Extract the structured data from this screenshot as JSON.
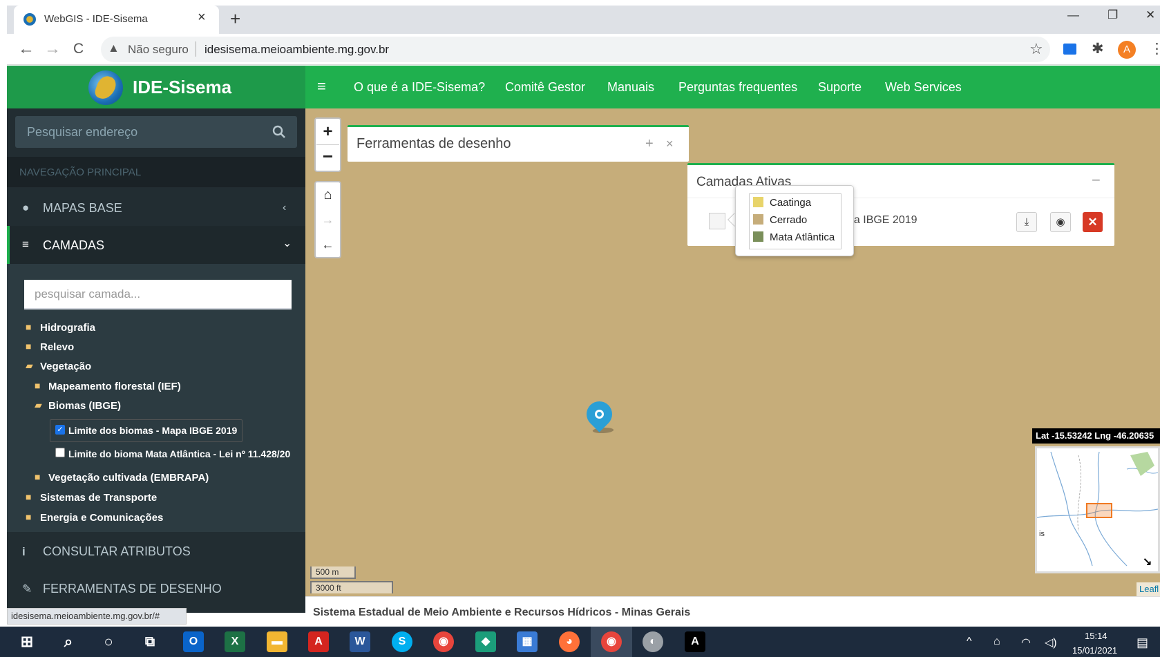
{
  "browser": {
    "tab_title": "WebGIS - IDE-Sisema",
    "tab_close": "×",
    "new_tab": "+",
    "win_min": "—",
    "win_restore": "❐",
    "win_close": "✕",
    "back": "←",
    "forward": "→",
    "reload": "C",
    "insecure_icon": "▲",
    "insecure_label": "Não seguro",
    "url": "idesisema.meioambiente.mg.gov.br",
    "star": "☆",
    "extensions": "✱",
    "profile_initial": "A",
    "menu": "⋮",
    "status_url": "idesisema.meioambiente.mg.gov.br/#"
  },
  "header": {
    "brand": "IDE-Sisema",
    "menu_toggle": "≡",
    "nav": [
      "O que é a IDE-Sisema?",
      "Comitê Gestor",
      "Manuais",
      "Perguntas frequentes",
      "Suporte",
      "Web Services"
    ]
  },
  "sidebar": {
    "search_placeholder": "Pesquisar endereço",
    "nav_header": "NAVEGAÇÃO PRINCIPAL",
    "items": [
      {
        "icon": "●",
        "label": "MAPAS BASE",
        "arrow": "‹"
      },
      {
        "icon": "≡",
        "label": "CAMADAS",
        "arrow": "⌄"
      },
      {
        "icon": "i",
        "label": "CONSULTAR ATRIBUTOS"
      },
      {
        "icon": "✎",
        "label": "FERRAMENTAS DE DESENHO"
      }
    ],
    "layer_search_placeholder": "pesquisar camada...",
    "tree": [
      "Hidrografia",
      "Relevo",
      "Vegetação",
      "Mapeamento florestal (IEF)",
      "Biomas (IBGE)",
      "Limite dos biomas - Mapa IBGE 2019",
      "Limite do bioma Mata Atlântica - Lei nº 11.428/20",
      "Vegetação cultivada (EMBRAPA)",
      "Sistemas de Transporte",
      "Energia e Comunicações"
    ],
    "check_mark": "✓"
  },
  "map": {
    "zoom_in": "+",
    "zoom_out": "−",
    "home": "⌂",
    "forward": "→",
    "back": "←",
    "draw_panel_title": "Ferramentas de desenho",
    "draw_add": "+",
    "draw_close": "×",
    "active_title": "Camadas Ativas",
    "active_minimize": "−",
    "layer_name_partial": "pa IBGE 2019",
    "download_icon": "⤓",
    "visibility_icon": "◉",
    "delete_icon": "✕",
    "legend": [
      {
        "label": "Caatinga",
        "color": "#e8d46a"
      },
      {
        "label": "Cerrado",
        "color": "#c6ad7a"
      },
      {
        "label": "Mata Atlântica",
        "color": "#7a8f5a"
      }
    ],
    "latlng": "Lat -15.53242 Lng -46.20635",
    "minimap_label": "is",
    "minimap_toggle": "↘",
    "scale_metric": "500 m",
    "scale_imperial": "3000 ft",
    "attribution": "Leafl",
    "footer": "Sistema Estadual de Meio Ambiente e Recursos Hídricos - Minas Gerais"
  },
  "colors": {
    "header_green": "#1fb04e",
    "map_background": "#c6ad7a",
    "sidebar_dark": "#222d32"
  },
  "taskbar": {
    "start": "⊞",
    "search": "⌕",
    "cortana": "○",
    "taskview": "⧉",
    "apps": [
      {
        "name": "outlook",
        "glyph": "O",
        "color": "#0a64c9"
      },
      {
        "name": "excel",
        "glyph": "X",
        "color": "#1d7145"
      },
      {
        "name": "explorer",
        "glyph": "▬",
        "color": "#f2b632"
      },
      {
        "name": "acrobat",
        "glyph": "A",
        "color": "#d4251f"
      },
      {
        "name": "word",
        "glyph": "W",
        "color": "#2b579a"
      },
      {
        "name": "skype",
        "glyph": "S",
        "color": "#00aff0"
      },
      {
        "name": "chrome",
        "glyph": "◉",
        "color": "#e8453c"
      },
      {
        "name": "app",
        "glyph": "◆",
        "color": "#1b9d7a"
      },
      {
        "name": "calendar",
        "glyph": "▦",
        "color": "#3a7bd5"
      },
      {
        "name": "firefox",
        "glyph": "◕",
        "color": "#ff7139"
      },
      {
        "name": "chrome-profile",
        "glyph": "◉",
        "color": "#e8453c"
      },
      {
        "name": "app2",
        "glyph": "◐",
        "color": "#9aa0a6"
      },
      {
        "name": "acrobat2",
        "glyph": "A",
        "color": "#000000"
      }
    ],
    "tray": [
      "^",
      "⌂",
      "◠",
      "◁)"
    ],
    "time": "15:14",
    "date": "15/01/2021",
    "notifications": "▤"
  }
}
